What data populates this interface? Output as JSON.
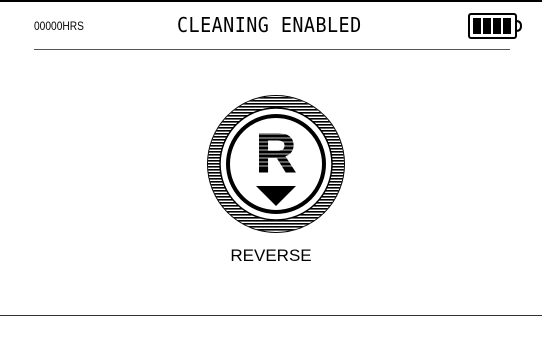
{
  "status_bar": {
    "hours": "00000HRS",
    "title": "CLEANING ENABLED",
    "battery_level": 1.0,
    "battery_icon": "battery-full-icon"
  },
  "mode": {
    "letter": "R",
    "label": "REVERSE",
    "icon": "reverse-mode-icon"
  },
  "colors": {
    "foreground": "#000000",
    "background": "#ffffff"
  }
}
